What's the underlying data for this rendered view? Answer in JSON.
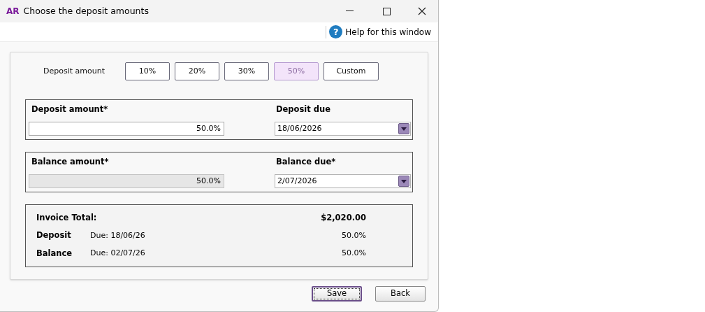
{
  "window": {
    "logo": "AR",
    "title": "Choose the deposit amounts"
  },
  "help": {
    "label": "Help for this window",
    "icon": "?"
  },
  "presets": {
    "label": "Deposit amount",
    "buttons": [
      {
        "label": "10%",
        "selected": false
      },
      {
        "label": "20%",
        "selected": false
      },
      {
        "label": "30%",
        "selected": false
      },
      {
        "label": "50%",
        "selected": true
      },
      {
        "label": "Custom",
        "selected": false
      }
    ]
  },
  "groups": [
    {
      "amount_label": "Deposit amount*",
      "amount_value": "50.0%",
      "amount_disabled": false,
      "due_label": "Deposit due",
      "due_value": "18/06/2026"
    },
    {
      "amount_label": "Balance amount*",
      "amount_value": "50.0%",
      "amount_disabled": true,
      "due_label": "Balance due*",
      "due_value": "2/07/2026"
    }
  ],
  "summary": {
    "total_label": "Invoice Total:",
    "total_value": "$2,020.00",
    "rows": [
      {
        "label": "Deposit",
        "due": "Due: 18/06/26",
        "value": "50.0%"
      },
      {
        "label": "Balance",
        "due": "Due: 02/07/26",
        "value": "50.0%"
      }
    ]
  },
  "buttons": [
    {
      "label": "Save",
      "selected": true
    },
    {
      "label": "Back",
      "selected": false
    }
  ]
}
